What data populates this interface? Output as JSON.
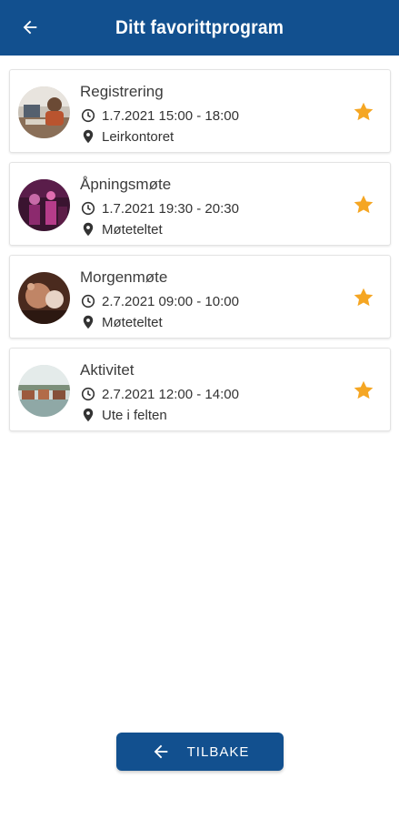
{
  "header": {
    "title": "Ditt favorittprogram",
    "back_icon": "arrow-left-icon",
    "background": "#12508f"
  },
  "program": [
    {
      "name": "Registrering",
      "time": "1.7.2021 15:00 - 18:00",
      "place": "Leirkontoret",
      "favorite": true
    },
    {
      "name": "Åpningsmøte",
      "time": "1.7.2021 19:30 - 20:30",
      "place": "Møteteltet",
      "favorite": true
    },
    {
      "name": "Morgenmøte",
      "time": "2.7.2021 09:00 - 10:00",
      "place": "Møteteltet",
      "favorite": true
    },
    {
      "name": "Aktivitet",
      "time": "2.7.2021 12:00 - 14:00",
      "place": "Ute i felten",
      "favorite": true
    }
  ],
  "icons": {
    "time": "clock-icon",
    "place": "map-pin-icon",
    "favorite": "star-icon"
  },
  "colors": {
    "accent": "#12508f",
    "star": "#f5a623"
  },
  "footer": {
    "back_label": "TILBAKE"
  }
}
